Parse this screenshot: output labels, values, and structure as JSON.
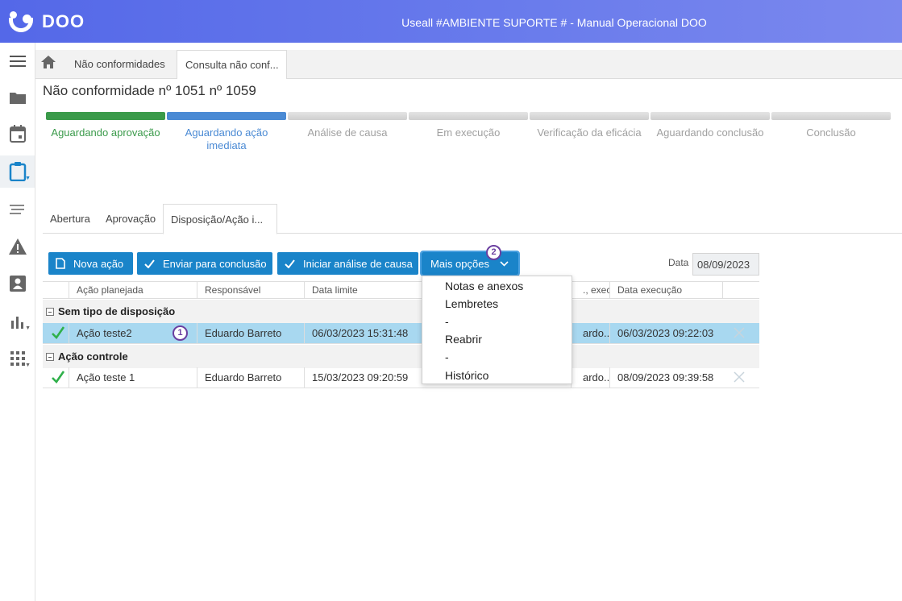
{
  "header": {
    "logo_text": "DOO",
    "title": "Useall #AMBIENTE SUPORTE # - Manual Operacional DOO"
  },
  "sidebar": {
    "icons": [
      "menu-icon",
      "folder-icon",
      "calendar-icon",
      "clipboard-icon",
      "list-icon",
      "warning-icon",
      "contact-icon",
      "chart-icon",
      "apps-icon"
    ]
  },
  "tabs": {
    "tab1": "Não conformidades",
    "tab2": "Consulta não conf..."
  },
  "page": {
    "title": "Não conformidade nº 1051 nº 1059"
  },
  "stages": {
    "s1": "Aguardando aprovação",
    "s2a": "Aguardando ação",
    "s2b": "imediata",
    "s3": "Análise de causa",
    "s4": "Em execução",
    "s5": "Verificação da eficácia",
    "s6": "Aguardando conclusão",
    "s7": "Conclusão"
  },
  "subtabs": {
    "t1": "Abertura",
    "t2": "Aprovação",
    "t3": "Disposição/Ação i..."
  },
  "toolbar": {
    "new_action": "Nova ação",
    "send": "Enviar para conclusão",
    "start": "Iniciar análise de causa",
    "more": "Mais opções",
    "badge_more": "2",
    "date_label": "Data",
    "date_value": "08/09/2023"
  },
  "grid": {
    "headers": {
      "action": "Ação planejada",
      "responsible": "Responsável",
      "deadline": "Data limite",
      "exec_resp": "., execuçã",
      "exec_date": "Data execução"
    },
    "group1": "Sem tipo de disposição",
    "group2": "Ação controle",
    "row1": {
      "action": "Ação teste2",
      "badge": "1",
      "responsible": "Eduardo Barreto",
      "deadline": "06/03/2023 15:31:48",
      "exec_resp": "ardo...",
      "exec_date": "06/03/2023 09:22:03"
    },
    "row2": {
      "action": "Ação teste 1",
      "responsible": "Eduardo Barreto",
      "deadline": "15/03/2023 09:20:59",
      "exec_resp": "ardo...",
      "exec_date": "08/09/2023 09:39:58"
    }
  },
  "menu": {
    "i1": "Notas e anexos",
    "i2": "Lembretes",
    "i3": "-",
    "i4": "Reabrir",
    "i5": "-",
    "i6": "Histórico"
  },
  "colors": {
    "header_gradient": "#5468e8",
    "done": "#3a9a4a",
    "current": "#4a8ad4",
    "button": "#1a84c9",
    "selected_row": "#a8d8f0"
  }
}
